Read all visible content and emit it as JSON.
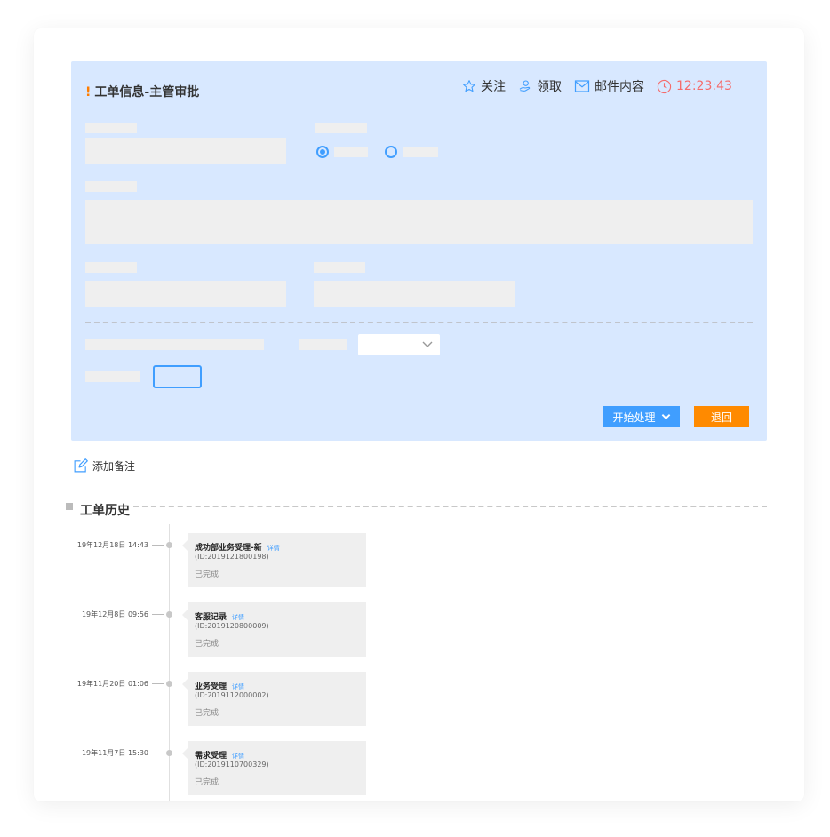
{
  "panel": {
    "title_mark": "!",
    "title": "工单信息-主管审批",
    "actions": {
      "follow": "关注",
      "claim": "领取",
      "mail": "邮件内容",
      "timer": "12:23:43"
    },
    "buttons": {
      "start": "开始处理",
      "back": "退回"
    }
  },
  "note": {
    "label": "添加备注"
  },
  "history": {
    "title": "工单历史",
    "items": [
      {
        "time": "19年12月18日 14:43",
        "title": "成功部业务受理-新",
        "link": "详情",
        "id": "(ID:2019121800198)",
        "status": "已完成"
      },
      {
        "time": "19年12月8日 09:56",
        "title": "客服记录",
        "link": "详情",
        "id": "(ID:2019120800009)",
        "status": "已完成"
      },
      {
        "time": "19年11月20日 01:06",
        "title": "业务受理",
        "link": "详情",
        "id": "(ID:2019112000002)",
        "status": "已完成"
      },
      {
        "time": "19年11月7日 15:30",
        "title": "需求受理",
        "link": "详情",
        "id": "(ID:2019110700329)",
        "status": "已完成"
      }
    ]
  },
  "colors": {
    "panel_bg": "#d8e8ff",
    "primary": "#409eff",
    "warning": "#ff8a00",
    "danger": "#f56c6c"
  }
}
